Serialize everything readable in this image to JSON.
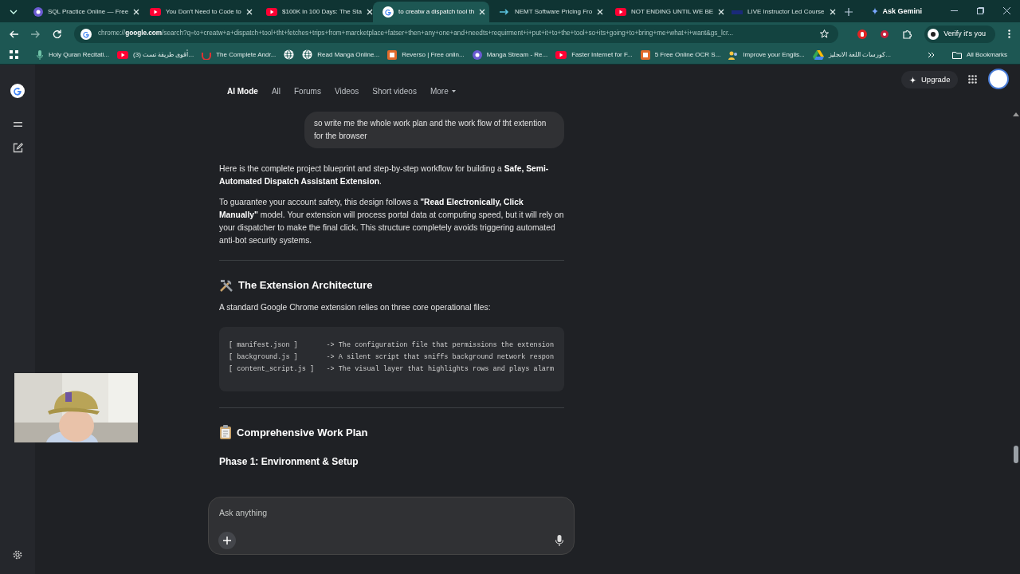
{
  "tabs": [
    {
      "title": "SQL Practice Online — Free",
      "selected": false
    },
    {
      "title": "You Don't Need to Code to",
      "selected": false
    },
    {
      "title": "$100K in 100 Days: The Sta",
      "selected": false
    },
    {
      "title": "to creatw a dispatch tool th",
      "selected": true
    },
    {
      "title": "NEMT Software Pricing Fro",
      "selected": false
    },
    {
      "title": "NOT ENDING UNTIL WE BE",
      "selected": false
    },
    {
      "title": "LIVE Instructor Led Course",
      "selected": false
    }
  ],
  "ask_gemini": "Ask Gemini",
  "address": "chrome://**google.com**/search?q=to+creatw+a+dispatch+tool+tht+fetches+trips+from+marcketplace+fatser+then+any+one+and+needts+requirment+i+put+it+to+the+tool+so+its+going+to+bring+me+what+i+want&gs_lcr...",
  "verify": "Verify it's you",
  "bookmarks": [
    "Holy Quran Recitati...",
    "(3) أقوى طريقة تست...",
    "The Complete Andr...",
    "Read Manga Online...",
    "Reverso | Free onlin...",
    "Manga Stream - Re...",
    "Faster Internet for F...",
    "5 Free Online OCR S...",
    "Improve your Englis...",
    "كورسات اللغة الانجليز..."
  ],
  "all_bookmarks": "All Bookmarks",
  "search_tabs": [
    {
      "label": "AI Mode",
      "selected": true
    },
    {
      "label": "All",
      "selected": false
    },
    {
      "label": "Forums",
      "selected": false
    },
    {
      "label": "Videos",
      "selected": false
    },
    {
      "label": "Short videos",
      "selected": false
    },
    {
      "label": "More",
      "selected": false
    }
  ],
  "upgrade": "Upgrade",
  "user_message": "so write me the whole work plan and the work flow of tht extention for the browser",
  "answer": [
    {
      "kind": "paragraph",
      "text": "Here is the complete project blueprint and step-by-step workflow for building a **Safe, Semi-Automated Dispatch Assistant Extension**."
    },
    {
      "kind": "paragraph",
      "text": "To guarantee your account safety, this design follows a **\"Read Electronically, Click Manually\"** model. Your extension will process portal data at computing speed, but it will rely on your dispatcher to make the final click. This structure completely avoids triggering automated anti-bot security systems."
    },
    {
      "kind": "divider"
    },
    {
      "kind": "heading",
      "text": "The Extension Architecture"
    },
    {
      "kind": "paragraph",
      "text": "A standard Google Chrome extension relies on three core operational files:"
    },
    {
      "kind": "code",
      "lines": [
        "[ manifest.json ]       -> The configuration file that permissions the extension",
        "[ background.js ]       -> A silent script that sniffs background network respon",
        "[ content_script.js ]   -> The visual layer that highlights rows and plays alarm"
      ]
    },
    {
      "kind": "divider"
    },
    {
      "kind": "heading",
      "text": "Comprehensive Work Plan"
    },
    {
      "kind": "subheading",
      "text": "Phase 1: Environment & Setup"
    }
  ],
  "composer": {
    "placeholder": "Ask anything"
  }
}
